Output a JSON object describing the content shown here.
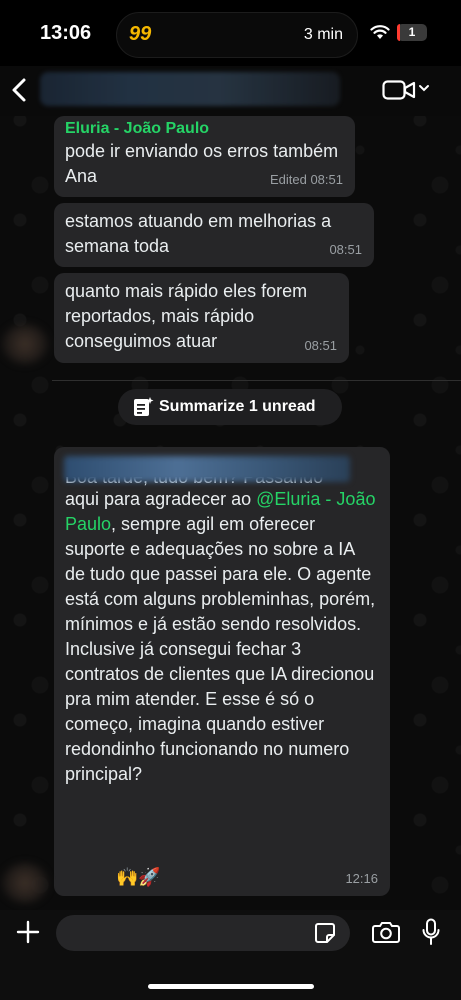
{
  "status_bar": {
    "time": "13:06",
    "app_badge": "99",
    "timer": "3 min",
    "battery": "1",
    "battery_level": 0.05
  },
  "messages": [
    {
      "sender": "Eluria - João Paulo",
      "text": "pode ir enviando os erros também Ana",
      "time": "Edited 08:51"
    },
    {
      "text": "estamos atuando em melhorias a semana toda",
      "time": "08:51"
    },
    {
      "text": "quanto mais rápido eles forem reportados, mais rápido conseguimos atuar",
      "time": "08:51"
    }
  ],
  "summarize": {
    "label": "Summarize 1 unread"
  },
  "incoming": {
    "partial_first_line": "Boa tarde, tudo bem? Passando",
    "text_before_mention": "aqui para agradecer ao ",
    "mention": "@Eluria - João Paulo",
    "text_after_mention": ", sempre agil em oferecer suporte e adequações no sobre a IA de tudo que passei para ele. O agente está com alguns probleminhas, porém, mínimos e já estão sendo resolvidos. Inclusive já consegui fechar 3 contratos de clientes que IA direcionou pra mim atender. E esse é só o começo, imagina quando estiver redondinho funcionando no numero principal?",
    "emoji": "🙌🚀",
    "time": "12:16"
  },
  "input": {
    "placeholder": ""
  }
}
